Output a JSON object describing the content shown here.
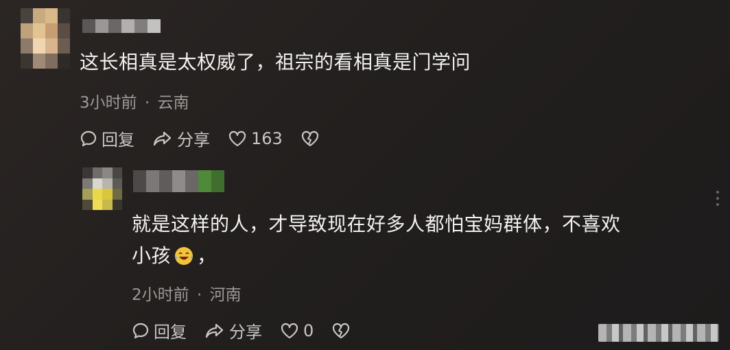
{
  "comments": [
    {
      "text": "这长相真是太权威了，祖宗的看相真是门学问",
      "time": "3小时前",
      "separator": "·",
      "location": "云南",
      "reply_label": "回复",
      "share_label": "分享",
      "like_count": "163"
    },
    {
      "text_line1": "就是这样的人，才导致现在好多人都怕宝妈群体，不喜欢",
      "text_line2": "小孩",
      "text_line2_suffix": "，",
      "time": "2小时前",
      "separator": "·",
      "location": "河南",
      "reply_label": "回复",
      "share_label": "分享",
      "like_count": "0"
    }
  ],
  "icons": {
    "reply": "comment-bubble-icon",
    "share": "share-arrow-icon",
    "like": "heart-icon",
    "dislike": "broken-heart-icon",
    "emoji": "crying-laughing-emoji-icon",
    "more": "more-dots-icon"
  },
  "colors": {
    "background": "#221f1e",
    "text": "#f2f2f2",
    "meta": "#9c9a99",
    "action": "#c9c7c6"
  }
}
